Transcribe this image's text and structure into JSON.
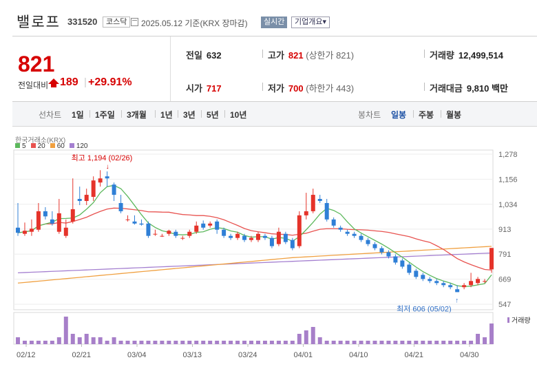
{
  "header": {
    "name": "밸로프",
    "code": "331520",
    "market": "코스닥",
    "date_info": "2025.05.12 기준(KRX 장마감)",
    "live_label": "실시간",
    "company_info_label": "기업개요",
    "company_info_arrow": "▾"
  },
  "quote": {
    "price": "821",
    "change_label": "전일대비",
    "change_value": "189",
    "change_pct": "+29.91%",
    "prev_close_label": "전일",
    "prev_close": "632",
    "open_label": "시가",
    "open": "717",
    "high_label": "고가",
    "high": "821",
    "high_limit": "(상한가 821)",
    "low_label": "저가",
    "low": "700",
    "low_limit": "(하한가 443)",
    "volume_label": "거래량",
    "volume": "12,499,514",
    "amount_label": "거래대금",
    "amount": "9,810",
    "amount_unit": "백만",
    "up_color": "#d60000"
  },
  "period_bar": {
    "line_label": "선차트",
    "line_periods": [
      "1일",
      "1주일",
      "3개월",
      "1년",
      "3년",
      "5년",
      "10년"
    ],
    "candle_label": "봉차트",
    "candle_periods": [
      "일봉",
      "주봉",
      "월봉"
    ],
    "active_candle": "일봉"
  },
  "chart_data": {
    "type": "candlestick",
    "source_label": "한국거래소(KRX)",
    "legend": [
      {
        "name": "5",
        "color": "#5cb85c"
      },
      {
        "name": "20",
        "color": "#e8524f"
      },
      {
        "name": "60",
        "color": "#f0a040"
      },
      {
        "name": "120",
        "color": "#a47fd0"
      }
    ],
    "y_ticks": [
      "1,278",
      "1,156",
      "1,034",
      "913",
      "791",
      "669",
      "547"
    ],
    "ylim": [
      547,
      1278
    ],
    "x_ticks": [
      "02/12",
      "02/21",
      "03/04",
      "03/13",
      "03/24",
      "04/01",
      "04/10",
      "04/21",
      "04/30"
    ],
    "volume_label": "거래량",
    "high_annotation": "최고 1,194 (02/26)",
    "low_annotation": "최저 606 (05/02)",
    "candles": [
      [
        920,
        895,
        1040,
        880
      ],
      [
        890,
        905,
        945,
        880
      ],
      [
        900,
        915,
        960,
        880
      ],
      [
        910,
        1000,
        1040,
        900
      ],
      [
        1000,
        975,
        1020,
        960
      ],
      [
        960,
        940,
        1000,
        930
      ],
      [
        900,
        990,
        1060,
        890
      ],
      [
        880,
        920,
        960,
        870
      ],
      [
        950,
        1010,
        1160,
        940
      ],
      [
        1060,
        1050,
        1120,
        1030
      ],
      [
        1050,
        1080,
        1110,
        1030
      ],
      [
        1070,
        1150,
        1170,
        1050
      ],
      [
        1140,
        1160,
        1200,
        1120
      ],
      [
        1170,
        1160,
        1194,
        1120
      ],
      [
        1130,
        1080,
        1140,
        1050
      ],
      [
        1040,
        1000,
        1080,
        990
      ],
      [
        960,
        960,
        980,
        950
      ],
      [
        950,
        940,
        980,
        935
      ],
      [
        940,
        935,
        960,
        930
      ],
      [
        940,
        880,
        950,
        870
      ],
      [
        890,
        890,
        910,
        880
      ],
      [
        880,
        880,
        890,
        875
      ],
      [
        890,
        905,
        910,
        880
      ],
      [
        900,
        880,
        910,
        870
      ],
      [
        870,
        870,
        880,
        860
      ],
      [
        880,
        900,
        910,
        870
      ],
      [
        900,
        930,
        950,
        890
      ],
      [
        940,
        920,
        955,
        910
      ],
      [
        930,
        940,
        950,
        920
      ],
      [
        950,
        910,
        960,
        890
      ],
      [
        910,
        880,
        920,
        870
      ],
      [
        880,
        870,
        890,
        860
      ],
      [
        870,
        890,
        900,
        860
      ],
      [
        880,
        860,
        890,
        850
      ],
      [
        860,
        870,
        880,
        850
      ],
      [
        860,
        890,
        900,
        850
      ],
      [
        880,
        870,
        890,
        860
      ],
      [
        870,
        830,
        880,
        820
      ],
      [
        840,
        900,
        920,
        830
      ],
      [
        890,
        850,
        900,
        840
      ],
      [
        860,
        820,
        870,
        810
      ],
      [
        830,
        980,
        1000,
        820
      ],
      [
        980,
        1000,
        1090,
        960
      ],
      [
        1000,
        1080,
        1110,
        990
      ],
      [
        1060,
        1050,
        1080,
        1040
      ],
      [
        1040,
        960,
        1060,
        950
      ],
      [
        960,
        930,
        970,
        920
      ],
      [
        920,
        910,
        930,
        900
      ],
      [
        900,
        890,
        910,
        880
      ],
      [
        890,
        880,
        900,
        870
      ],
      [
        880,
        860,
        890,
        850
      ],
      [
        860,
        840,
        870,
        830
      ],
      [
        840,
        820,
        850,
        810
      ],
      [
        820,
        800,
        830,
        790
      ],
      [
        800,
        780,
        810,
        770
      ],
      [
        780,
        750,
        790,
        740
      ],
      [
        760,
        730,
        770,
        720
      ],
      [
        740,
        700,
        750,
        690
      ],
      [
        710,
        680,
        720,
        670
      ],
      [
        690,
        670,
        700,
        660
      ],
      [
        670,
        660,
        680,
        650
      ],
      [
        660,
        650,
        670,
        640
      ],
      [
        650,
        640,
        660,
        630
      ],
      [
        640,
        630,
        650,
        620
      ],
      [
        620,
        606,
        640,
        606
      ],
      [
        630,
        640,
        650,
        620
      ],
      [
        640,
        660,
        700,
        630
      ],
      [
        650,
        670,
        680,
        640
      ],
      [
        660,
        660,
        670,
        650
      ],
      [
        717,
        821,
        821,
        700
      ]
    ],
    "volumes": [
      2,
      1,
      1,
      1,
      1,
      1,
      2,
      8,
      3,
      2,
      3,
      2,
      2,
      1,
      2,
      1,
      1,
      1,
      1,
      1,
      1,
      1,
      1,
      1,
      1,
      1,
      1,
      1,
      1,
      1,
      1,
      1,
      1,
      1,
      1,
      1,
      1,
      1,
      1,
      1,
      1,
      3,
      4,
      5,
      2,
      1,
      1,
      1,
      1,
      1,
      1,
      1,
      1,
      1,
      1,
      1,
      1,
      1,
      1,
      1,
      1,
      1,
      1,
      1,
      1,
      1,
      1,
      3,
      2,
      6
    ]
  }
}
